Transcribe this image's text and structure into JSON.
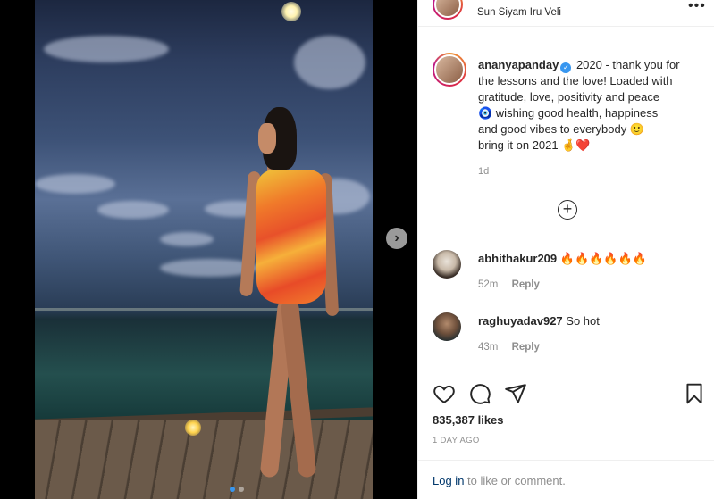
{
  "header": {
    "location": "Sun Siyam Iru Veli",
    "more_icon": "more-horizontal-icon"
  },
  "post": {
    "username": "ananyapanday",
    "verified": true,
    "caption_line1": "2020 - thank you for",
    "caption_line2": "the lessons and the love! Loaded with",
    "caption_line3": "gratitude, love, positivity and peace",
    "caption_line4": "🧿 wishing good health, happiness",
    "caption_line5": "and good vibes to everybody 🙂",
    "caption_line6": "bring it on 2021 🤞❤️",
    "time_ago": "1d",
    "likes": "835,387 likes",
    "date": "1 DAY AGO"
  },
  "comments": [
    {
      "username": "abhithakur209",
      "text": "🔥🔥🔥🔥🔥🔥",
      "time": "52m",
      "reply": "Reply"
    },
    {
      "username": "raghuyadav927",
      "text": "So hot",
      "time": "43m",
      "reply": "Reply"
    }
  ],
  "footer": {
    "login_link": "Log in",
    "login_rest": " to like or comment."
  },
  "colors": {
    "link": "#00376b",
    "muted": "#8e8e8e",
    "text": "#262626",
    "verified": "#3897f0"
  },
  "carousel": {
    "current": 1,
    "total": 2
  }
}
